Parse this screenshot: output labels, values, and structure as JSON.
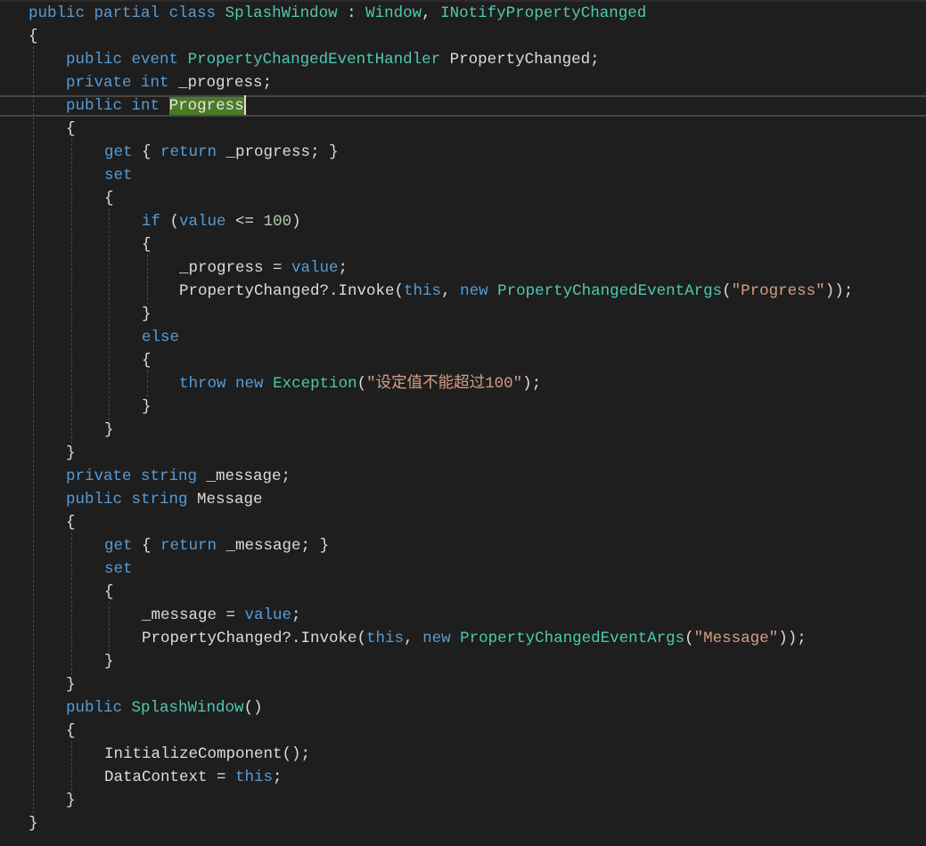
{
  "editor": {
    "lines": [
      [
        [
          "kw",
          "public"
        ],
        [
          "pl",
          " "
        ],
        [
          "kw",
          "partial"
        ],
        [
          "pl",
          " "
        ],
        [
          "kw",
          "class"
        ],
        [
          "pl",
          " "
        ],
        [
          "ty",
          "SplashWindow"
        ],
        [
          "pl",
          " : "
        ],
        [
          "ty",
          "Window"
        ],
        [
          "pl",
          ", "
        ],
        [
          "ty",
          "INotifyPropertyChanged"
        ]
      ],
      [
        [
          "pl",
          "{"
        ]
      ],
      [
        [
          "kw",
          "public"
        ],
        [
          "pl",
          " "
        ],
        [
          "kw",
          "event"
        ],
        [
          "pl",
          " "
        ],
        [
          "ty",
          "PropertyChangedEventHandler"
        ],
        [
          "pl",
          " PropertyChanged;"
        ]
      ],
      [
        [
          "kw",
          "private"
        ],
        [
          "pl",
          " "
        ],
        [
          "kw",
          "int"
        ],
        [
          "pl",
          " _progress;"
        ]
      ],
      [
        [
          "kw",
          "public"
        ],
        [
          "pl",
          " "
        ],
        [
          "kw",
          "int"
        ],
        [
          "pl",
          " "
        ],
        [
          "hl",
          "Progress"
        ]
      ],
      [
        [
          "pl",
          "{"
        ]
      ],
      [
        [
          "kw",
          "get"
        ],
        [
          "pl",
          " { "
        ],
        [
          "kw",
          "return"
        ],
        [
          "pl",
          " _progress; }"
        ]
      ],
      [
        [
          "kw",
          "set"
        ]
      ],
      [
        [
          "pl",
          "{"
        ]
      ],
      [
        [
          "kw",
          "if"
        ],
        [
          "pl",
          " ("
        ],
        [
          "kw",
          "value"
        ],
        [
          "pl",
          " <= "
        ],
        [
          "nm",
          "100"
        ],
        [
          "pl",
          ")"
        ]
      ],
      [
        [
          "pl",
          "{"
        ]
      ],
      [
        [
          "pl",
          "_progress = "
        ],
        [
          "kw",
          "value"
        ],
        [
          "pl",
          ";"
        ]
      ],
      [
        [
          "pl",
          "PropertyChanged?.Invoke("
        ],
        [
          "kw",
          "this"
        ],
        [
          "pl",
          ", "
        ],
        [
          "kw",
          "new"
        ],
        [
          "pl",
          " "
        ],
        [
          "ty",
          "PropertyChangedEventArgs"
        ],
        [
          "pl",
          "("
        ],
        [
          "st",
          "\"Progress\""
        ],
        [
          "pl",
          "));"
        ]
      ],
      [
        [
          "pl",
          "}"
        ]
      ],
      [
        [
          "kw",
          "else"
        ]
      ],
      [
        [
          "pl",
          "{"
        ]
      ],
      [
        [
          "kw",
          "throw"
        ],
        [
          "pl",
          " "
        ],
        [
          "kw",
          "new"
        ],
        [
          "pl",
          " "
        ],
        [
          "ty",
          "Exception"
        ],
        [
          "pl",
          "("
        ],
        [
          "st",
          "\"设定值不能超过100\""
        ],
        [
          "pl",
          ");"
        ]
      ],
      [
        [
          "pl",
          "}"
        ]
      ],
      [
        [
          "pl",
          "}"
        ]
      ],
      [
        [
          "pl",
          "}"
        ]
      ],
      [
        [
          "kw",
          "private"
        ],
        [
          "pl",
          " "
        ],
        [
          "kw",
          "string"
        ],
        [
          "pl",
          " _message;"
        ]
      ],
      [
        [
          "kw",
          "public"
        ],
        [
          "pl",
          " "
        ],
        [
          "kw",
          "string"
        ],
        [
          "pl",
          " Message"
        ]
      ],
      [
        [
          "pl",
          "{"
        ]
      ],
      [
        [
          "kw",
          "get"
        ],
        [
          "pl",
          " { "
        ],
        [
          "kw",
          "return"
        ],
        [
          "pl",
          " _message; }"
        ]
      ],
      [
        [
          "kw",
          "set"
        ]
      ],
      [
        [
          "pl",
          "{"
        ]
      ],
      [
        [
          "pl",
          "_message = "
        ],
        [
          "kw",
          "value"
        ],
        [
          "pl",
          ";"
        ]
      ],
      [
        [
          "pl",
          "PropertyChanged?.Invoke("
        ],
        [
          "kw",
          "this"
        ],
        [
          "pl",
          ", "
        ],
        [
          "kw",
          "new"
        ],
        [
          "pl",
          " "
        ],
        [
          "ty",
          "PropertyChangedEventArgs"
        ],
        [
          "pl",
          "("
        ],
        [
          "st",
          "\"Message\""
        ],
        [
          "pl",
          "));"
        ]
      ],
      [
        [
          "pl",
          "}"
        ]
      ],
      [
        [
          "pl",
          "}"
        ]
      ],
      [
        [
          "kw",
          "public"
        ],
        [
          "pl",
          " "
        ],
        [
          "ty",
          "SplashWindow"
        ],
        [
          "pl",
          "()"
        ]
      ],
      [
        [
          "pl",
          "{"
        ]
      ],
      [
        [
          "pl",
          "InitializeComponent();"
        ]
      ],
      [
        [
          "pl",
          "DataContext = "
        ],
        [
          "kw",
          "this"
        ],
        [
          "pl",
          ";"
        ]
      ],
      [
        [
          "pl",
          "}"
        ]
      ],
      [
        [
          "pl",
          "}"
        ]
      ]
    ]
  },
  "colors": {
    "background": "#1e1e1e",
    "keyword": "#569cd6",
    "type": "#4ec9b0",
    "string": "#d69d85",
    "number": "#b5cea8",
    "plain": "#dcdcdc",
    "highlight": "#4a7a26"
  }
}
